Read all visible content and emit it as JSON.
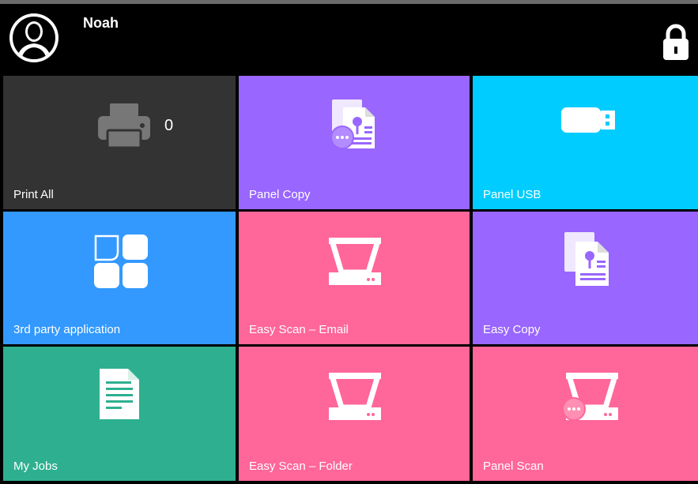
{
  "header": {
    "username": "Noah",
    "avatar_icon": "user-avatar-icon",
    "lock_icon": "lock-icon"
  },
  "tiles": [
    {
      "label": "Print All",
      "icon": "printer-icon",
      "count": "0",
      "color": "#333333"
    },
    {
      "label": "Panel Copy",
      "icon": "copy-more-icon",
      "color": "#9966ff"
    },
    {
      "label": "Panel USB",
      "icon": "usb-drive-icon",
      "color": "#00ccff"
    },
    {
      "label": "3rd party application",
      "icon": "apps-grid-icon",
      "color": "#3399ff"
    },
    {
      "label": "Easy Scan – Email",
      "icon": "scanner-icon",
      "color": "#ff6699"
    },
    {
      "label": "Easy Copy",
      "icon": "copy-icon",
      "color": "#9966ff"
    },
    {
      "label": "My Jobs",
      "icon": "document-icon",
      "color": "#2eb090"
    },
    {
      "label": "Easy Scan – Folder",
      "icon": "scanner-icon",
      "color": "#ff6699"
    },
    {
      "label": "Panel Scan",
      "icon": "scanner-more-icon",
      "color": "#ff6699"
    }
  ]
}
